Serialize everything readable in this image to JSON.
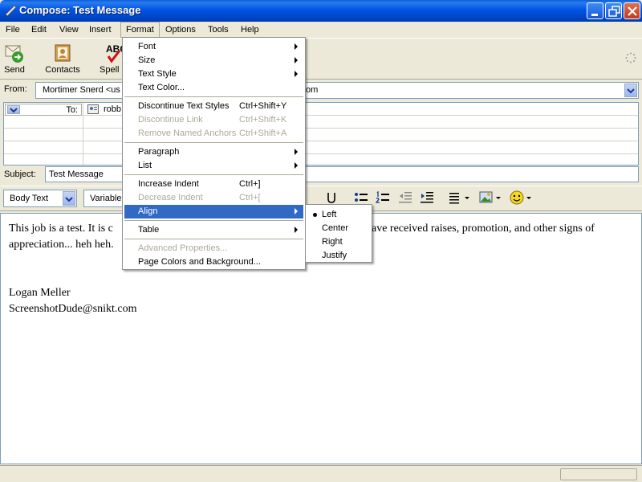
{
  "window": {
    "title": "Compose: Test Message"
  },
  "menubar": [
    "File",
    "Edit",
    "View",
    "Insert",
    "Format",
    "Options",
    "Tools",
    "Help"
  ],
  "toolbar": {
    "send": "Send",
    "contacts": "Contacts",
    "spell": "Spell",
    "spell_icon_text": "ABC"
  },
  "address": {
    "from_label": "From:",
    "from_value": "Mortimer Snerd <us",
    "from_value_tail": "om",
    "to_label": "To:",
    "to_value": "robb",
    "subject_label": "Subject:",
    "subject_value": "Test Message"
  },
  "format_toolbar": {
    "paragraph_style": "Body Text",
    "font": "Variable"
  },
  "body": {
    "lines": [
      "This job is a test.  It is c",
      "appreciation... heh heh.",
      "Logan Meller",
      "ScreenshotDude@snikt.com"
    ],
    "line1_tail": "ave received raises, promotion, and other signs of"
  },
  "format_menu": {
    "items": [
      {
        "label": "Font",
        "submenu": true
      },
      {
        "label": "Size",
        "submenu": true
      },
      {
        "label": "Text Style",
        "submenu": true
      },
      {
        "label": "Text Color..."
      },
      {
        "label": "Discontinue Text Styles",
        "shortcut": "Ctrl+Shift+Y"
      },
      {
        "label": "Discontinue Link",
        "shortcut": "Ctrl+Shift+K",
        "disabled": true
      },
      {
        "label": "Remove Named Anchors",
        "shortcut": "Ctrl+Shift+A",
        "disabled": true
      },
      {
        "label": "Paragraph",
        "submenu": true
      },
      {
        "label": "List",
        "submenu": true
      },
      {
        "label": "Increase Indent",
        "shortcut": "Ctrl+]"
      },
      {
        "label": "Decrease Indent",
        "shortcut": "Ctrl+[",
        "disabled": true
      },
      {
        "label": "Align",
        "submenu": true,
        "highlighted": true
      },
      {
        "label": "Table",
        "submenu": true
      },
      {
        "label": "Advanced Properties...",
        "disabled": true
      },
      {
        "label": "Page Colors and Background..."
      }
    ]
  },
  "align_menu": {
    "items": [
      "Left",
      "Center",
      "Right",
      "Justify"
    ],
    "selected": "Left"
  },
  "colors": {
    "title_bar": "#0054e3",
    "menu_highlight": "#316ac5",
    "chrome": "#ece9d8"
  }
}
